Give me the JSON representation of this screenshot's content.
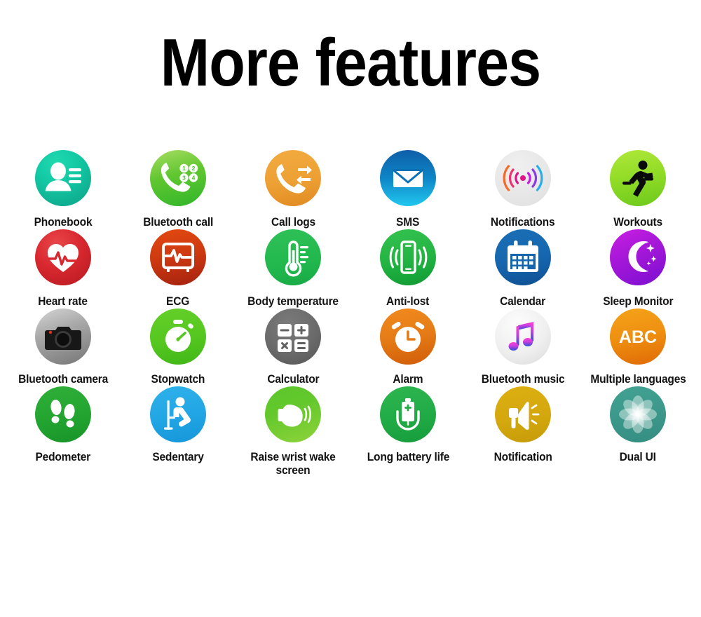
{
  "header": {
    "title": "More features"
  },
  "features": [
    [
      {
        "label": "Phonebook",
        "icon": "contact-person-icon",
        "theme": "phonebook",
        "color": "#12c9a4"
      },
      {
        "label": "Bluetooth call",
        "icon": "phone-keypad-icon",
        "theme": "btcall",
        "color": "#5fc62f"
      },
      {
        "label": "Call logs",
        "icon": "phone-exchange-icon",
        "theme": "calllogs",
        "color": "#eda034"
      },
      {
        "label": "SMS",
        "icon": "envelope-icon",
        "theme": "sms",
        "color": "#0e85c6"
      },
      {
        "label": "Notifications",
        "icon": "signal-waves-icon",
        "theme": "notif1",
        "color": "#e6e6e6"
      },
      {
        "label": "Workouts",
        "icon": "running-person-icon",
        "theme": "workouts",
        "color": "#8fdb26"
      }
    ],
    [
      {
        "label": "Heart rate",
        "icon": "heart-pulse-icon",
        "theme": "heart",
        "color": "#d8282f"
      },
      {
        "label": "ECG",
        "icon": "ecg-monitor-icon",
        "theme": "ecg",
        "color": "#cf3a10"
      },
      {
        "label": "Body temperature",
        "icon": "thermometer-icon",
        "theme": "temp",
        "color": "#22b84e"
      },
      {
        "label": "Anti-lost",
        "icon": "phone-vibrate-icon",
        "theme": "antilost",
        "color": "#22b342"
      },
      {
        "label": "Calendar",
        "icon": "calendar-icon",
        "theme": "calendar",
        "color": "#1566ae"
      },
      {
        "label": "Sleep Monitor",
        "icon": "moon-stars-icon",
        "theme": "sleep",
        "color": "#a417d8"
      }
    ],
    [
      {
        "label": "Bluetooth camera",
        "icon": "camera-icon",
        "theme": "camera",
        "color": "#a8a8a8"
      },
      {
        "label": "Stopwatch",
        "icon": "stopwatch-icon",
        "theme": "stopwatch",
        "color": "#55c71f"
      },
      {
        "label": "Calculator",
        "icon": "calculator-keys-icon",
        "theme": "calculator",
        "color": "#6a6a6a"
      },
      {
        "label": "Alarm",
        "icon": "alarm-clock-icon",
        "theme": "alarm",
        "color": "#e57b16"
      },
      {
        "label": "Bluetooth music",
        "icon": "music-note-icon",
        "theme": "music",
        "color": "#efefef"
      },
      {
        "label": "Multiple languages",
        "icon": "abc-letters-icon",
        "theme": "langs",
        "color": "#ee8f10",
        "icon_text": "ABC"
      }
    ],
    [
      {
        "label": "Pedometer",
        "icon": "footprints-icon",
        "theme": "pedometer",
        "color": "#23a430"
      },
      {
        "label": "Sedentary",
        "icon": "seated-person-icon",
        "theme": "sedentary",
        "color": "#21a5e4"
      },
      {
        "label": "Raise wrist wake screen",
        "icon": "raised-wrist-icon",
        "theme": "raisewrist",
        "color": "#63c82c"
      },
      {
        "label": "Long battery life",
        "icon": "battery-charge-icon",
        "theme": "battery",
        "color": "#21ab46"
      },
      {
        "label": "Notification",
        "icon": "megaphone-icon",
        "theme": "notif2",
        "color": "#d4a80e"
      },
      {
        "label": "Dual UI",
        "icon": "flower-petals-icon",
        "theme": "dualui",
        "color": "#3b978a"
      }
    ]
  ],
  "keypad_digits": [
    "1",
    "2",
    "3",
    "4"
  ]
}
